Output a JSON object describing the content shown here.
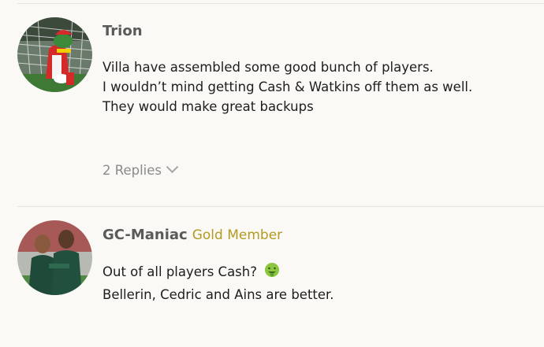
{
  "posts": [
    {
      "username": "Trion",
      "flair": "",
      "lines": [
        "Villa have assembled some good bunch of players.",
        "I wouldn’t mind getting Cash & Watkins off them as well.",
        "They would make great backups"
      ],
      "replies_label": "2 Replies",
      "avatar_icon": "mascot-avatar-icon"
    },
    {
      "username": "GC-Maniac",
      "flair": "Gold Member",
      "lines": [
        "Out of all players Cash?",
        "Bellerin, Cedric and Ains are better."
      ],
      "emoji_icon": "nauseated-face-emoji",
      "avatar_icon": "two-men-avatar-icon"
    }
  ],
  "colors": {
    "flair": "#b39a22",
    "username": "#5a5a5a",
    "replies": "#8a8a8a",
    "background": "#faf9f6"
  }
}
